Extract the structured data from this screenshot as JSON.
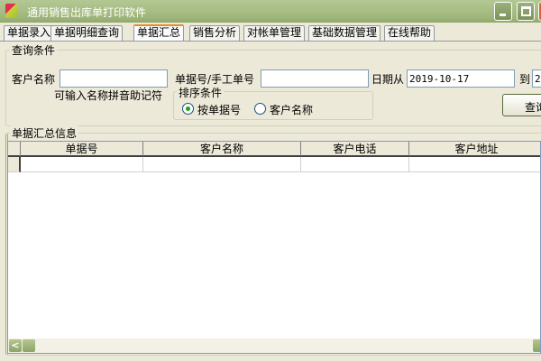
{
  "window": {
    "title": "通用销售出库单打印软件"
  },
  "tabs": [
    {
      "label": "单据录入",
      "active": false
    },
    {
      "label": "单据明细查询",
      "active": false
    },
    {
      "label": "单据汇总",
      "active": true
    },
    {
      "label": "销售分析",
      "active": false
    },
    {
      "label": "对帐单管理",
      "active": false
    },
    {
      "label": "基础数据管理",
      "active": false
    },
    {
      "label": "在线帮助",
      "active": false
    }
  ],
  "query": {
    "group_label": "查询条件",
    "customer_label": "客户名称",
    "customer_value": "",
    "customer_hint": "可输入名称拼音助记符",
    "bill_label": "单据号/手工单号",
    "bill_value": "",
    "date_from_label": "日期从",
    "date_from_value": "2019-10-17",
    "date_to_label": "到",
    "date_to_value": "2",
    "sort_group_label": "排序条件",
    "sort_options": [
      {
        "label": "按单据号",
        "selected": true
      },
      {
        "label": "客户名称",
        "selected": false
      }
    ],
    "query_button": "查询"
  },
  "summary": {
    "group_label": "单据汇总信息",
    "columns": [
      "单据号",
      "客户名称",
      "客户电话",
      "客户地址"
    ]
  }
}
